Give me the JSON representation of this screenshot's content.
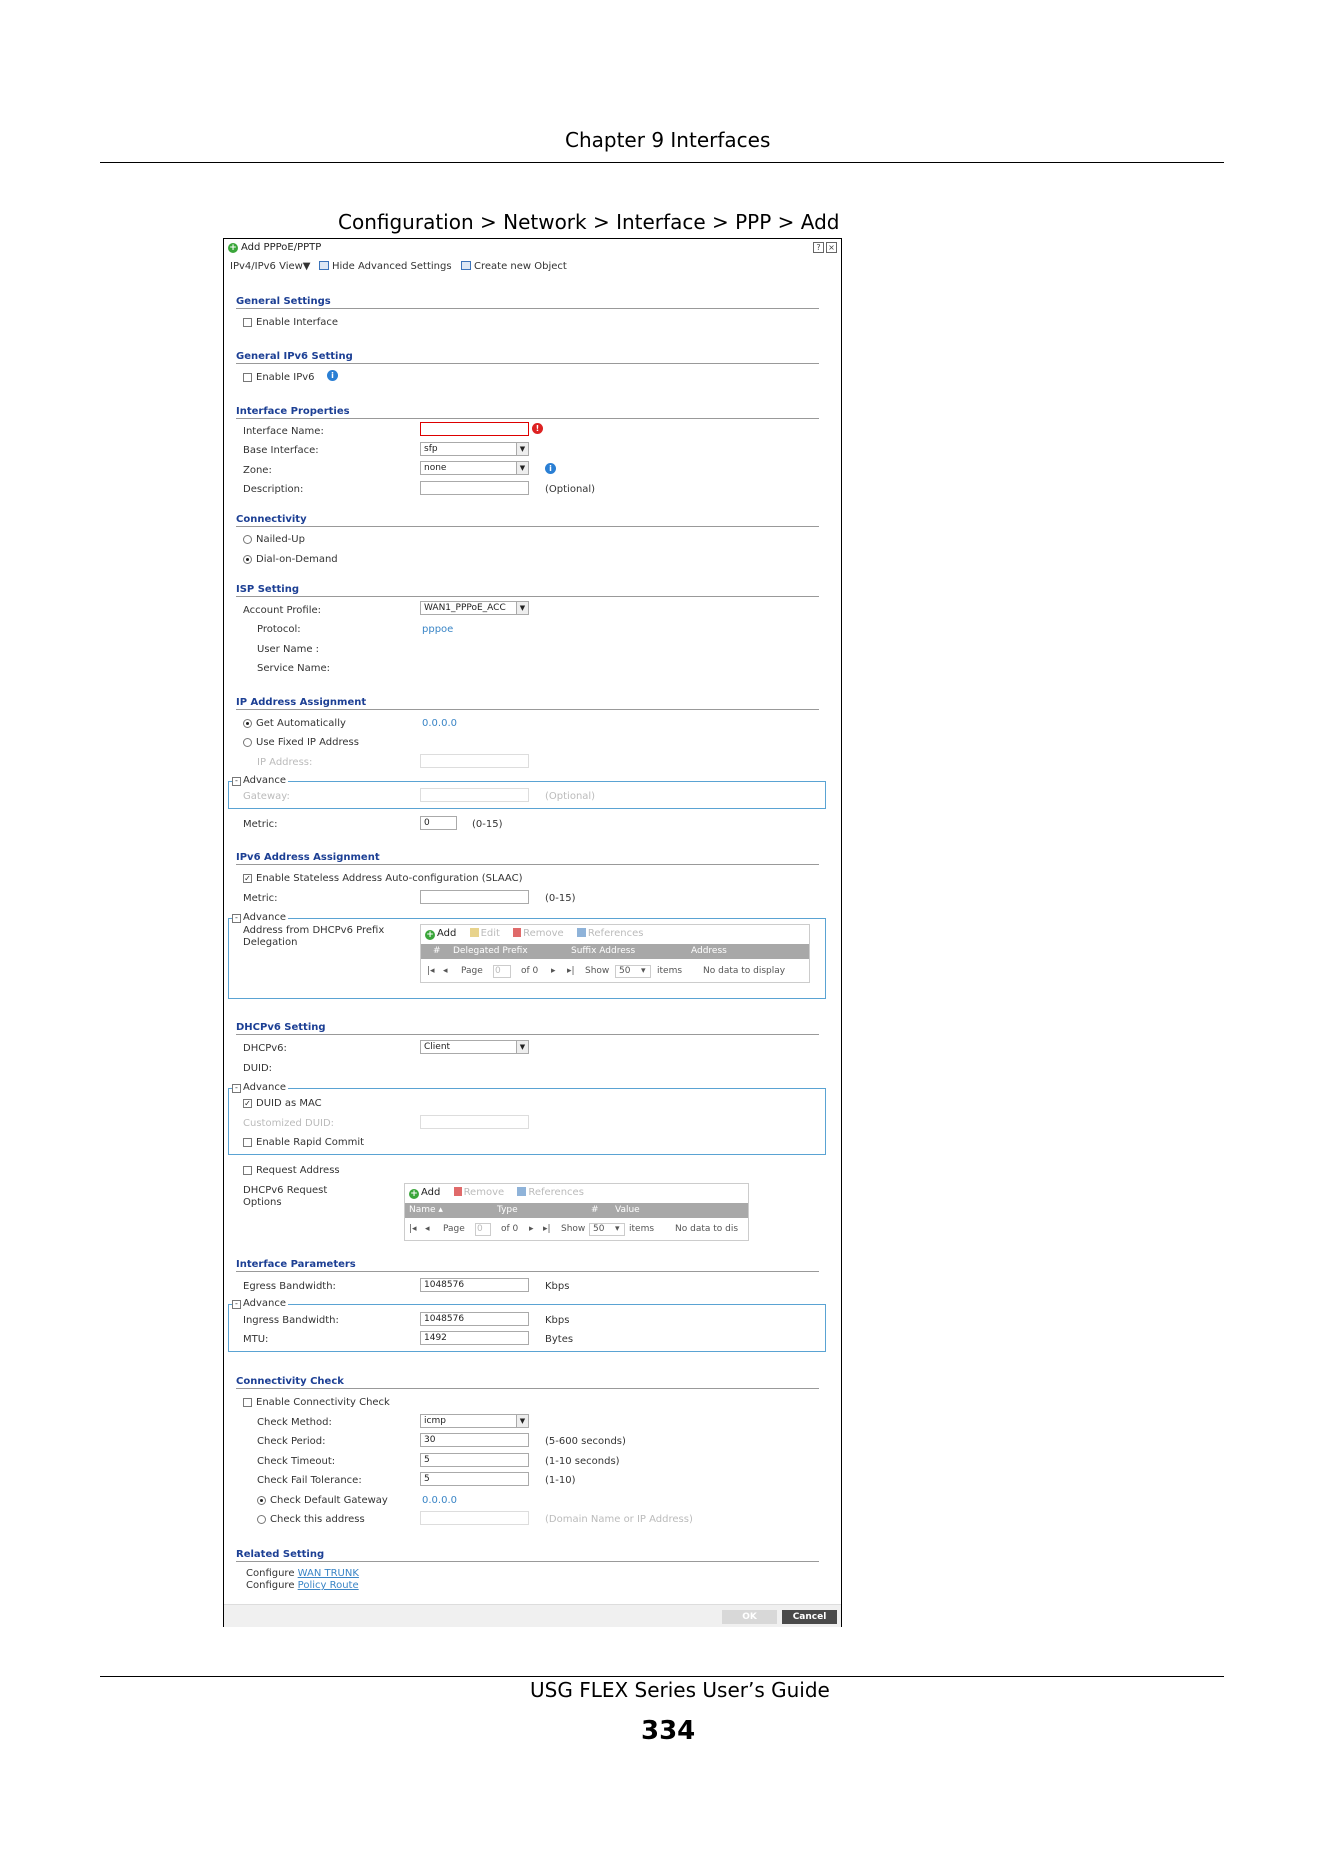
{
  "page": {
    "chapter": "Chapter 9 Interfaces",
    "caption": "Configuration > Network > Interface > PPP > Add",
    "guide": "USG FLEX Series User’s Guide",
    "page_number": "334"
  },
  "dialog": {
    "title": "Add PPPoE/PPTP",
    "toolbar": {
      "view": "IPv4/IPv6 View▼",
      "hide_advanced": "Hide Advanced Settings",
      "create_object": "Create new Object"
    },
    "general": {
      "heading": "General Settings",
      "enable_interface": "Enable Interface",
      "enable_interface_checked": false
    },
    "general_ipv6": {
      "heading": "General IPv6 Setting",
      "enable_ipv6": "Enable IPv6",
      "enable_ipv6_checked": false
    },
    "interface_properties": {
      "heading": "Interface Properties",
      "name_label": "Interface Name:",
      "name_value": "",
      "base_label": "Base Interface:",
      "base_value": "sfp",
      "zone_label": "Zone:",
      "zone_value": "none",
      "description_label": "Description:",
      "description_value": "",
      "optional": "(Optional)"
    },
    "connectivity": {
      "heading": "Connectivity",
      "nailed_up": "Nailed-Up",
      "dial_on_demand": "Dial-on-Demand",
      "selected": "dial_on_demand"
    },
    "isp": {
      "heading": "ISP Setting",
      "account_label": "Account Profile:",
      "account_value": "WAN1_PPPoE_ACC",
      "protocol_label": "Protocol:",
      "protocol_value": "pppoe",
      "user_label": "User Name :",
      "service_label": "Service Name:"
    },
    "ip_assignment": {
      "heading": "IP Address Assignment",
      "get_auto": "Get Automatically",
      "get_auto_value": "0.0.0.0",
      "use_fixed": "Use Fixed IP Address",
      "ip_label": "IP Address:",
      "advance": "Advance",
      "gateway_label": "Gateway:",
      "gateway_optional": "(Optional)",
      "metric_label": "Metric:",
      "metric_value": "0",
      "metric_range": "(0-15)"
    },
    "ipv6_assignment": {
      "heading": "IPv6 Address Assignment",
      "slaac": "Enable Stateless Address Auto-configuration (SLAAC)",
      "slaac_checked": true,
      "metric_label": "Metric:",
      "metric_value": "",
      "metric_range": "(0-15)",
      "advance": "Advance",
      "prefix_label_1": "Address from DHCPv6 Prefix",
      "prefix_label_2": "Delegation",
      "grid": {
        "add": "Add",
        "edit": "Edit",
        "remove": "Remove",
        "references": "References",
        "columns": [
          "#",
          "Delegated Prefix",
          "Suffix Address",
          "Address"
        ],
        "page": "Page",
        "page_value": "0",
        "of": "of 0",
        "show": "Show",
        "show_value": "50",
        "items": "items",
        "empty": "No data to display"
      }
    },
    "dhcpv6": {
      "heading": "DHCPv6 Setting",
      "dhcpv6_label": "DHCPv6:",
      "dhcpv6_value": "Client",
      "duid_label": "DUID:",
      "advance": "Advance",
      "duid_as_mac": "DUID as MAC",
      "duid_as_mac_checked": true,
      "customized_duid": "Customized DUID:",
      "rapid_commit": "Enable Rapid Commit",
      "request_address": "Request Address",
      "request_options_1": "DHCPv6 Request",
      "request_options_2": "Options",
      "grid": {
        "add": "Add",
        "remove": "Remove",
        "references": "References",
        "columns": [
          "Name ▴",
          "Type",
          "#",
          "Value"
        ],
        "page": "Page",
        "page_value": "0",
        "of": "of 0",
        "show": "Show",
        "show_value": "50",
        "items": "items",
        "empty": "No data to dis"
      }
    },
    "interface_params": {
      "heading": "Interface Parameters",
      "egress_label": "Egress Bandwidth:",
      "egress_value": "1048576",
      "egress_unit": "Kbps",
      "advance": "Advance",
      "ingress_label": "Ingress Bandwidth:",
      "ingress_value": "1048576",
      "ingress_unit": "Kbps",
      "mtu_label": "MTU:",
      "mtu_value": "1492",
      "mtu_unit": "Bytes"
    },
    "connectivity_check": {
      "heading": "Connectivity Check",
      "enable": "Enable Connectivity Check",
      "method_label": "Check Method:",
      "method_value": "icmp",
      "period_label": "Check Period:",
      "period_value": "30",
      "period_range": "(5-600 seconds)",
      "timeout_label": "Check Timeout:",
      "timeout_value": "5",
      "timeout_range": "(1-10 seconds)",
      "fail_label": "Check Fail Tolerance:",
      "fail_value": "5",
      "fail_range": "(1-10)",
      "default_gw": "Check Default Gateway",
      "default_gw_value": "0.0.0.0",
      "this_address": "Check this address",
      "this_address_hint": "(Domain Name or IP Address)"
    },
    "related": {
      "heading": "Related Setting",
      "configure": "Configure",
      "wan_trunk": "WAN TRUNK",
      "policy_route": "Policy Route"
    },
    "buttons": {
      "ok": "OK",
      "cancel": "Cancel"
    }
  }
}
